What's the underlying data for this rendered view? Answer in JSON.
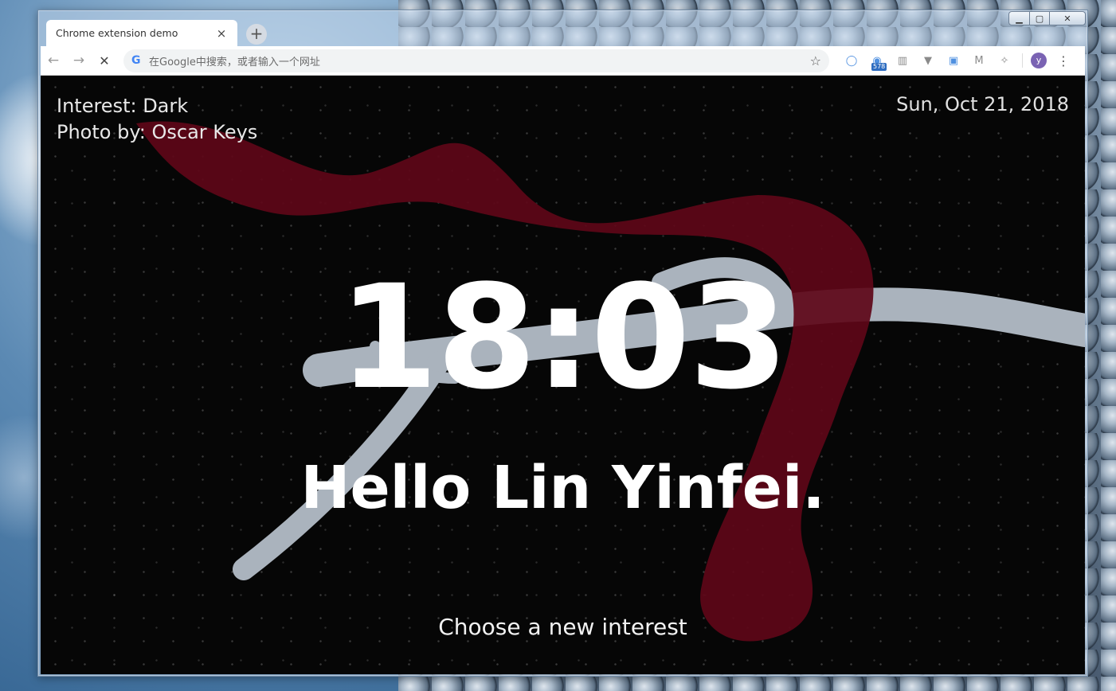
{
  "browser": {
    "tab_title": "Chrome extension demo",
    "tab_close": "×",
    "new_tab": "+",
    "omnibox_placeholder": "在Google中搜索，或者输入一个网址",
    "omnibox_g": "G",
    "back": "←",
    "forward": "→",
    "stop": "✕",
    "star": "☆",
    "extensions": [
      {
        "name": "circle-extension",
        "glyph": "◯"
      },
      {
        "name": "counter-extension",
        "glyph": "◉",
        "badge": "578"
      },
      {
        "name": "reader-extension",
        "glyph": "▥"
      },
      {
        "name": "v-extension",
        "glyph": "▼"
      },
      {
        "name": "edit-extension",
        "glyph": "▣"
      },
      {
        "name": "m-extension",
        "glyph": "M"
      },
      {
        "name": "bird-extension",
        "glyph": "✧"
      }
    ],
    "avatar_letter": "y",
    "menu": "⋮",
    "window_controls": {
      "min": "▁",
      "max": "▢",
      "close": "✕"
    }
  },
  "page": {
    "interest": "Interest: Dark",
    "photo_credit": "Photo by: Oscar Keys",
    "date": "Sun, Oct 21, 2018",
    "clock": "18:03",
    "greeting": "Hello Lin Yinfei.",
    "choose_interest": "Choose a new interest"
  },
  "colors": {
    "scarf": "#6b0a1e",
    "antler": "#b9c0c8",
    "background": "#060606"
  }
}
